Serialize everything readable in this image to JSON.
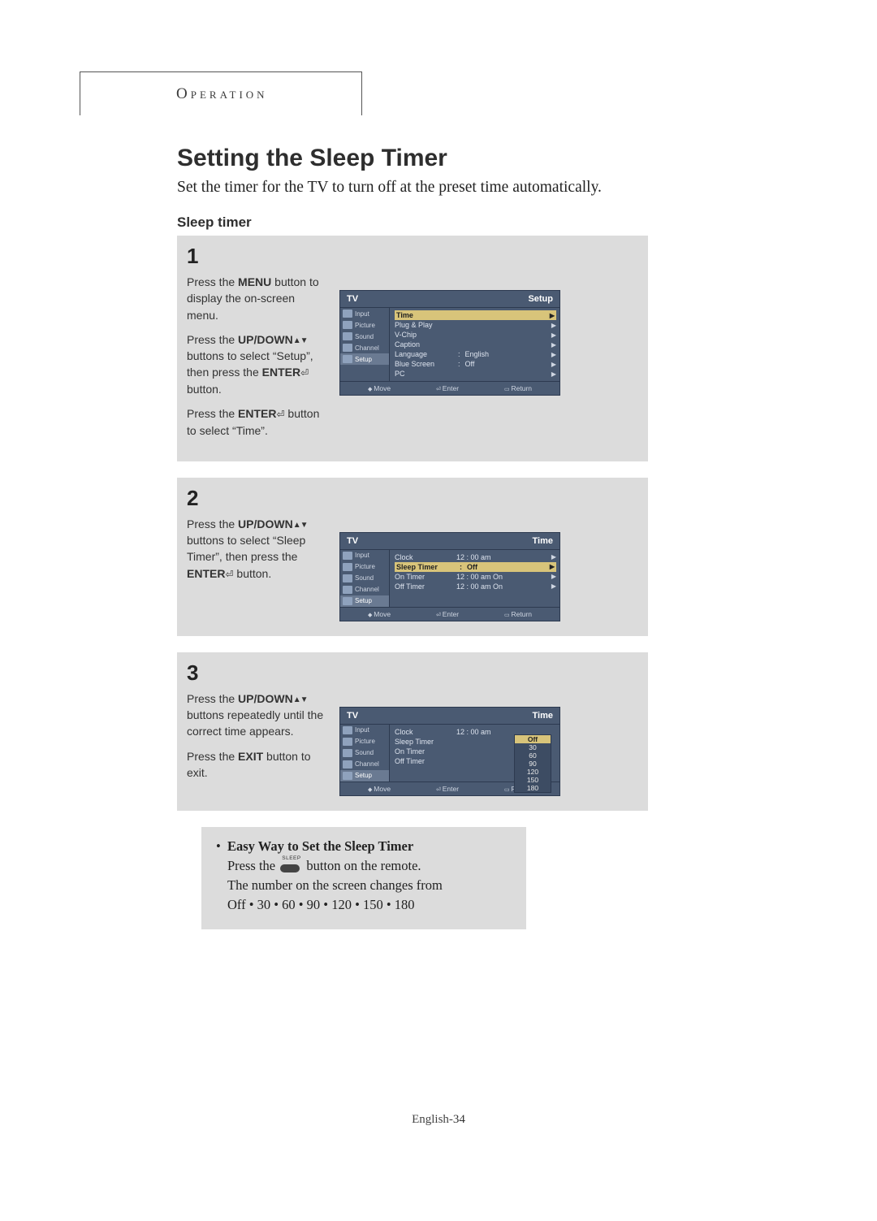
{
  "header": {
    "tab": "Operation"
  },
  "title": "Setting the Sleep Timer",
  "subtitle": "Set the timer for the TV to turn off at the preset time automatically.",
  "section_label": "Sleep timer",
  "steps": [
    {
      "num": "1",
      "paras": [
        "Press the <b>MENU</b> button to display the on-screen menu.",
        "Press the <b>UP/DOWN</b><span class=\"updown\"></span> buttons to select “Setup”, then press the <b>ENTER</b><span class=\"enter-icon\"></span> button.",
        "Press the <b>ENTER</b><span class=\"enter-icon\"></span> button to select “Time”."
      ],
      "osd": {
        "header_left": "TV",
        "header_right": "Setup",
        "side": [
          "Input",
          "Picture",
          "Sound",
          "Channel",
          "Setup"
        ],
        "side_selected": 4,
        "rows": [
          {
            "label": "Time",
            "value": "",
            "hl": true,
            "arrow": true,
            "colon": false
          },
          {
            "label": "Plug & Play",
            "value": "",
            "arrow": true,
            "colon": false
          },
          {
            "label": "V-Chip",
            "value": "",
            "arrow": true,
            "colon": false
          },
          {
            "label": "Caption",
            "value": "",
            "arrow": true,
            "colon": false
          },
          {
            "label": "Language",
            "value": "English",
            "arrow": true,
            "colon": true
          },
          {
            "label": "Blue Screen",
            "value": "Off",
            "arrow": true,
            "colon": true
          },
          {
            "label": "PC",
            "value": "",
            "arrow": true,
            "colon": false
          }
        ],
        "footer": {
          "move": "Move",
          "enter": "Enter",
          "return": "Return"
        }
      }
    },
    {
      "num": "2",
      "paras": [
        "Press the <b>UP/DOWN</b><span class=\"updown\"></span> buttons to select “Sleep Timer”, then press the <b>ENTER</b><span class=\"enter-icon\"></span> button."
      ],
      "osd": {
        "header_left": "TV",
        "header_right": "Time",
        "side": [
          "Input",
          "Picture",
          "Sound",
          "Channel",
          "Setup"
        ],
        "side_selected": 4,
        "rows": [
          {
            "label": "Clock",
            "value": "12 : 00  am",
            "arrow": true,
            "colon": false
          },
          {
            "label": "Sleep Timer",
            "value": "Off",
            "hl": true,
            "arrow": true,
            "colon": true
          },
          {
            "label": "On Timer",
            "value": "12 : 00  am On",
            "arrow": true,
            "colon": false
          },
          {
            "label": "Off Timer",
            "value": "12 : 00  am On",
            "arrow": true,
            "colon": false
          }
        ],
        "footer": {
          "move": "Move",
          "enter": "Enter",
          "return": "Return"
        }
      }
    },
    {
      "num": "3",
      "paras": [
        "Press the <b>UP/DOWN</b><span class=\"updown\"></span> buttons repeatedly until the correct time appears.",
        "Press the <b>EXIT</b> button to exit."
      ],
      "osd": {
        "header_left": "TV",
        "header_right": "Time",
        "side": [
          "Input",
          "Picture",
          "Sound",
          "Channel",
          "Setup"
        ],
        "side_selected": 4,
        "rows": [
          {
            "label": "Clock",
            "value": "12 : 00  am",
            "arrow": false,
            "colon": false
          },
          {
            "label": "Sleep Timer",
            "value": "",
            "arrow": false,
            "colon": false
          },
          {
            "label": "On Timer",
            "value": "",
            "arrow": false,
            "colon": false
          },
          {
            "label": "Off Timer",
            "value": "",
            "arrow": false,
            "colon": false
          }
        ],
        "dropdown": {
          "options": [
            "Off",
            "30",
            "60",
            "90",
            "120",
            "150",
            "180"
          ],
          "selected": 0
        },
        "footer": {
          "move": "Move",
          "enter": "Enter",
          "return": "Return"
        }
      }
    }
  ],
  "easy": {
    "title": "Easy Way to Set the Sleep Timer",
    "line1_a": "Press the",
    "sleep_label": "SLEEP",
    "line1_b": "button on the remote.",
    "line2": "The number on the screen changes from",
    "line3": "Off • 30 • 60 • 90 • 120 • 150 • 180"
  },
  "footer": {
    "lang": "English-",
    "page": "34"
  }
}
